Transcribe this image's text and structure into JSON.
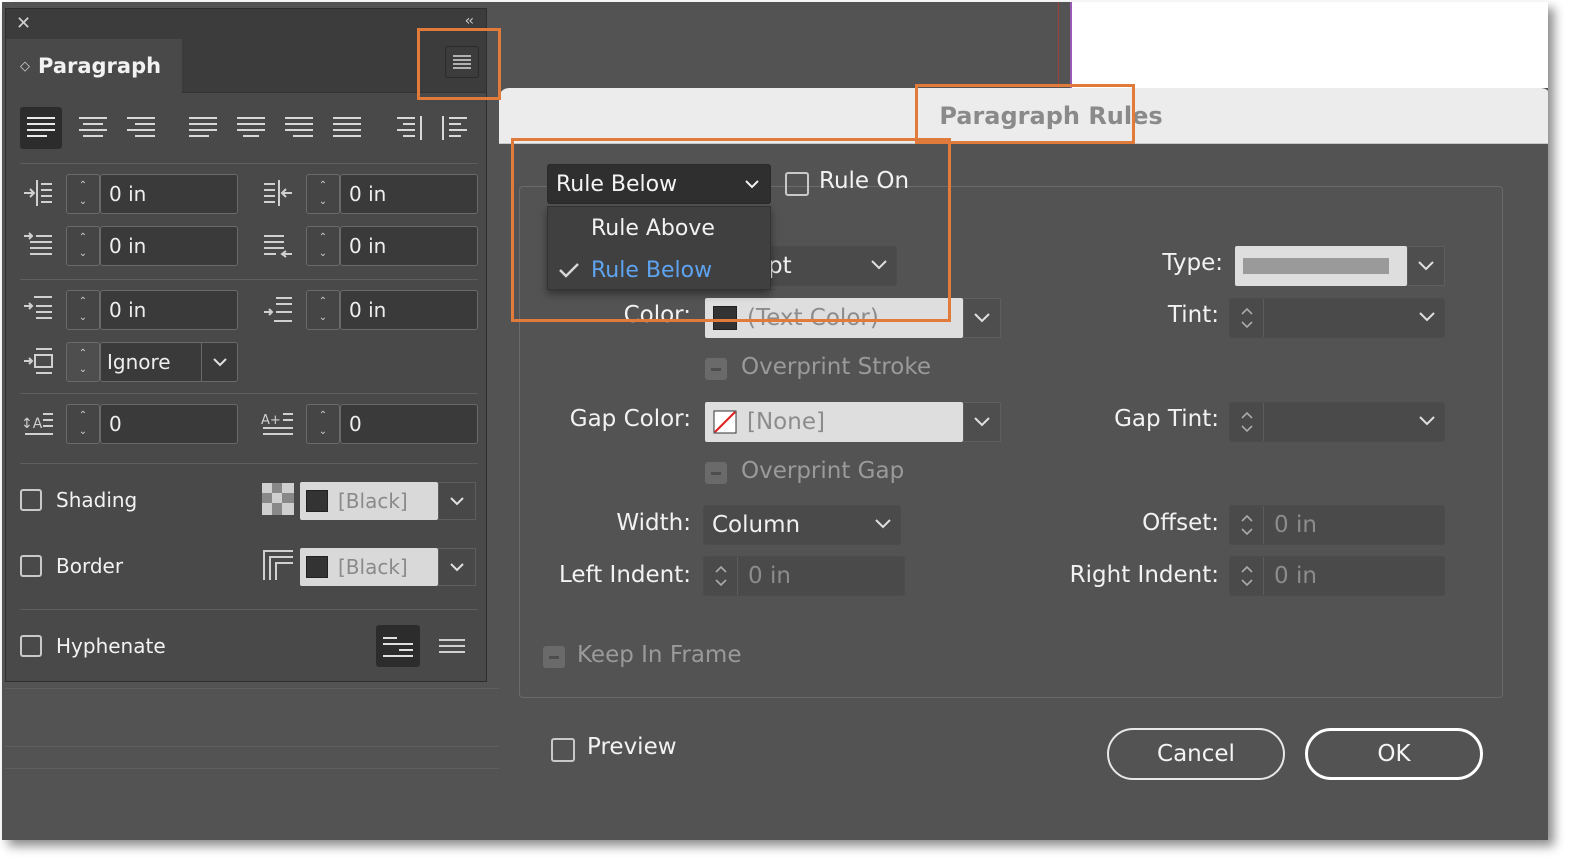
{
  "panel": {
    "title": "Paragraph",
    "collapse_label": "‹‹",
    "close_label": "✕",
    "indents": {
      "left_indent": "0 in",
      "right_indent": "0 in",
      "first_line_indent": "0 in",
      "last_line_indent": "0 in",
      "space_before": "0 in",
      "space_after": "0 in",
      "align_to_grid": "Ignore",
      "drop_cap_lines": "0",
      "drop_cap_chars": "0"
    },
    "shading_label": "Shading",
    "shading_color": "[Black]",
    "border_label": "Border",
    "border_color": "[Black]",
    "hyphenate_label": "Hyphenate"
  },
  "dialog": {
    "title": "Paragraph Rules",
    "rule_select_value": "Rule Below",
    "rule_options": [
      "Rule Above",
      "Rule Below"
    ],
    "rule_on_label": "Rule On",
    "weight_partial": "pt",
    "color_label": "Color:",
    "color_value": "(Text Color)",
    "overprint_stroke_label": "Overprint Stroke",
    "gap_color_label": "Gap Color:",
    "gap_color_value": "[None]",
    "overprint_gap_label": "Overprint Gap",
    "width_label": "Width:",
    "width_value": "Column",
    "left_indent_label": "Left Indent:",
    "left_indent_value": "0 in",
    "type_label": "Type:",
    "tint_label": "Tint:",
    "gap_tint_label": "Gap Tint:",
    "offset_label": "Offset:",
    "offset_value": "0 in",
    "right_indent_label": "Right Indent:",
    "right_indent_value": "0 in",
    "keep_in_frame_label": "Keep In Frame",
    "preview_label": "Preview",
    "cancel_label": "Cancel",
    "ok_label": "OK"
  },
  "colors": {
    "highlight": "#e07b3c",
    "selected_menu_item": "#5ea3ef",
    "panel_bg": "#494949",
    "dialog_bg": "#535353"
  }
}
